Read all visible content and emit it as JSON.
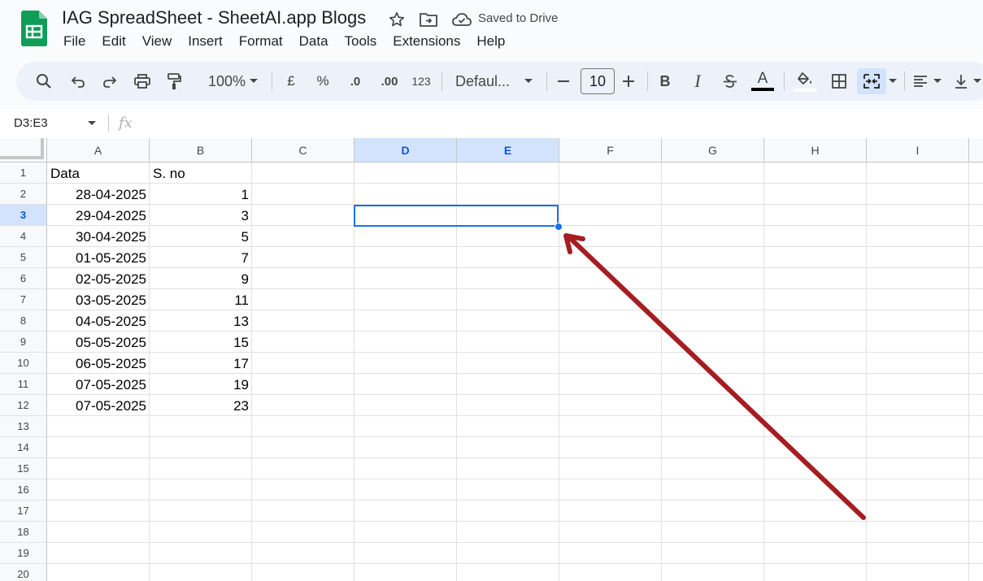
{
  "header": {
    "title": "IAG SpreadSheet - SheetAI.app Blogs",
    "saved_status": "Saved to Drive"
  },
  "menu": [
    "File",
    "Edit",
    "View",
    "Insert",
    "Format",
    "Data",
    "Tools",
    "Extensions",
    "Help"
  ],
  "toolbar": {
    "zoom": "100%",
    "currency": "£",
    "percent": "%",
    "decrease_decimal": ".0",
    "increase_decimal": ".00",
    "number_format": "123",
    "font": "Defaul...",
    "font_size": "10",
    "bold": "B",
    "italic": "I",
    "text_color": "A"
  },
  "formula_bar": {
    "name_box": "D3:E3",
    "fx": "fx"
  },
  "columns": [
    "A",
    "B",
    "C",
    "D",
    "E",
    "F",
    "G",
    "H",
    "I"
  ],
  "selected_columns": [
    "D",
    "E"
  ],
  "selected_row": 3,
  "rows": [
    "1",
    "2",
    "3",
    "4",
    "5",
    "6",
    "7",
    "8",
    "9",
    "10",
    "11",
    "12",
    "13",
    "14",
    "15",
    "16",
    "17",
    "18",
    "19",
    "20"
  ],
  "cells": {
    "A": [
      "Data",
      "28-04-2025",
      "29-04-2025",
      "30-04-2025",
      "01-05-2025",
      "02-05-2025",
      "03-05-2025",
      "04-05-2025",
      "05-05-2025",
      "06-05-2025",
      "07-05-2025",
      "07-05-2025"
    ],
    "B": [
      "S. no",
      "1",
      "3",
      "5",
      "7",
      "9",
      "11",
      "13",
      "15",
      "17",
      "19",
      "23"
    ]
  },
  "annotation": {
    "arrow_color": "#a51d22"
  },
  "colors": {
    "selection": "#1a73e8",
    "header_selected": "#d3e3fd"
  }
}
